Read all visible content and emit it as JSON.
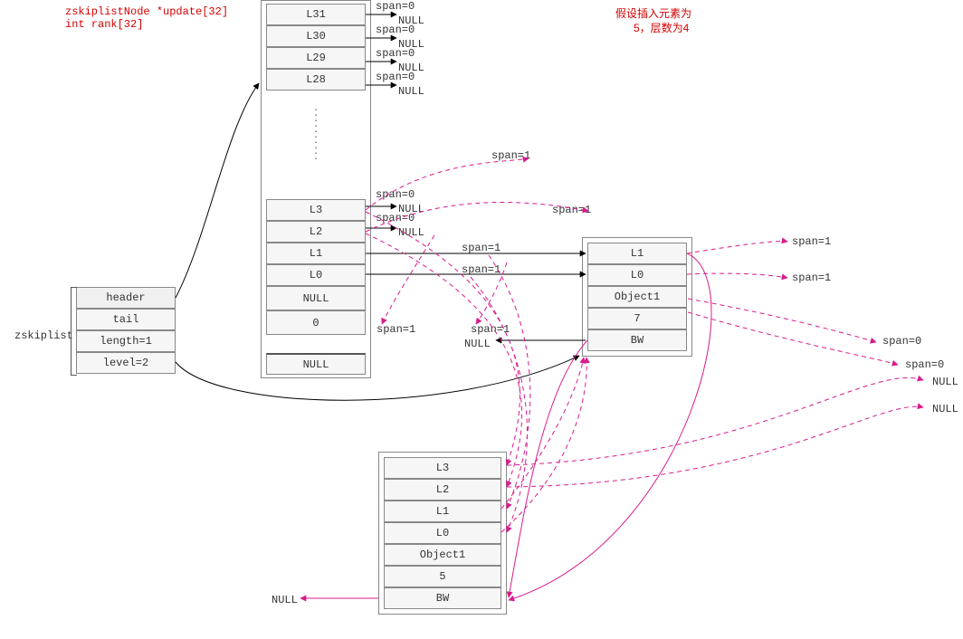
{
  "annotations": {
    "decl_line1": "zskiplistNode *update[32]",
    "decl_line2": "int rank[32]",
    "assumption_line1": "假设插入元素为",
    "assumption_line2": "5，层数为4"
  },
  "zskiplist": {
    "title": "zskiplist",
    "rows": [
      "header",
      "tail",
      "length=1",
      "level=2"
    ]
  },
  "header_node": {
    "levels_top": [
      "L31",
      "L30",
      "L29",
      "L28"
    ],
    "levels_mid": [
      "L3",
      "L2",
      "L1",
      "L0"
    ],
    "body": [
      "NULL",
      "0",
      "NULL"
    ]
  },
  "node7": {
    "rows": [
      "L1",
      "L0",
      "Object1",
      "7",
      "BW"
    ]
  },
  "new_node": {
    "rows": [
      "L3",
      "L2",
      "L1",
      "L0",
      "Object1",
      "5",
      "BW"
    ]
  },
  "span_labels": {
    "top31": "span=0",
    "top30": "span=0",
    "top29": "span=0",
    "top28": "span=0",
    "l3": "span=0",
    "l2": "span=0",
    "l1": "span=1",
    "l0": "span=1",
    "up_red_1": "span=1",
    "up_red_2": "span=1",
    "left_pink_1": "span=1",
    "left_pink_2": "span=1",
    "right_of_7_1": "span=1",
    "right_of_7_2": "span=1",
    "right_far_1": "span=0",
    "right_far_2": "span=0"
  },
  "null_labels": {
    "n31": "NULL",
    "n30": "NULL",
    "n29": "NULL",
    "n28": "NULL",
    "n_l3": "NULL",
    "n_l2": "NULL",
    "bw7": "NULL",
    "right_far_1": "NULL",
    "right_far_2": "NULL",
    "bw_new": "NULL"
  }
}
